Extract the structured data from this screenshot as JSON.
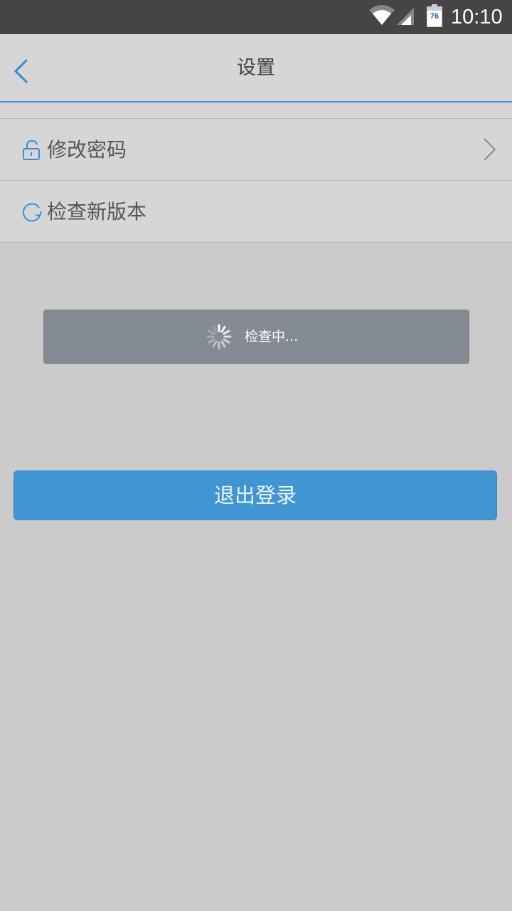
{
  "status_bar": {
    "battery_level": "76",
    "time": "10:10",
    "icons": [
      "wifi-icon",
      "signal-icon",
      "battery-icon"
    ]
  },
  "header": {
    "title": "设置",
    "back_icon": "chevron-left-icon"
  },
  "settings": {
    "items": [
      {
        "label": "修改密码",
        "icon": "lock-icon",
        "has_chevron": true
      },
      {
        "label": "检查新版本",
        "icon": "refresh-icon",
        "has_chevron": false
      }
    ]
  },
  "toast": {
    "text": "检查中...",
    "icon": "spinner-icon"
  },
  "logout": {
    "label": "退出登录"
  },
  "colors": {
    "accent": "#3f96d3",
    "background": "#cbcbcb",
    "panel": "#d6d6d6",
    "status_bar": "#454545",
    "toast": "#848b94"
  }
}
